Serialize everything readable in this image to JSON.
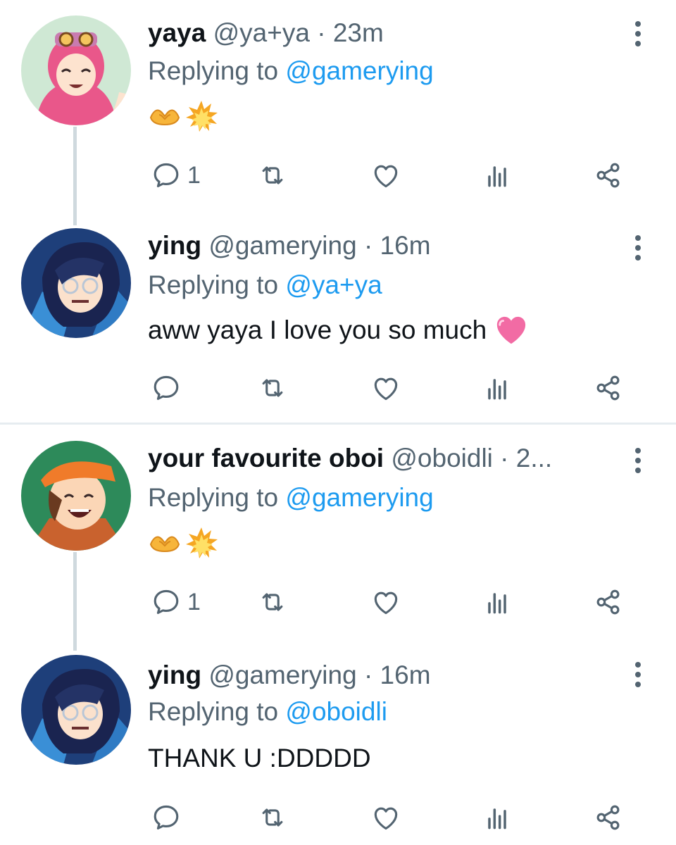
{
  "tweets": [
    {
      "name": "yaya",
      "handle": "@ya+ya",
      "dot": "·",
      "time": "23m",
      "replying_label": "Replying to",
      "replying_to": "@gamerying",
      "text": "",
      "emojis": [
        "heart-hands-emoji",
        "collision-emoji"
      ],
      "reply_count": "1",
      "avatar": "avatar-yaya"
    },
    {
      "name": "ying",
      "handle": "@gamerying",
      "dot": "·",
      "time": "16m",
      "replying_label": "Replying to",
      "replying_to": "@ya+ya",
      "text": "aww yaya I love you so much",
      "emojis": [
        "pink-heart-emoji"
      ],
      "reply_count": "",
      "avatar": "avatar-ying"
    },
    {
      "name": "your favourite oboi",
      "handle": "@oboidli",
      "dot": "·",
      "time": "2...",
      "replying_label": "Replying to",
      "replying_to": "@gamerying",
      "text": "",
      "emojis": [
        "heart-hands-emoji",
        "collision-emoji"
      ],
      "reply_count": "1",
      "avatar": "avatar-oboi"
    },
    {
      "name": "ying",
      "handle": "@gamerying",
      "dot": "·",
      "time": "16m",
      "replying_label": "Replying to",
      "replying_to": "@oboidli",
      "text": "THANK U :DDDDD",
      "emojis": [],
      "reply_count": "",
      "avatar": "avatar-ying"
    }
  ],
  "icons": [
    "reply-icon",
    "retweet-icon",
    "like-icon",
    "views-icon",
    "share-icon",
    "more-icon"
  ],
  "colors": {
    "link": "#1d9bf0",
    "muted": "#536471",
    "text": "#0f1419",
    "thread_line": "#cfd9de"
  }
}
